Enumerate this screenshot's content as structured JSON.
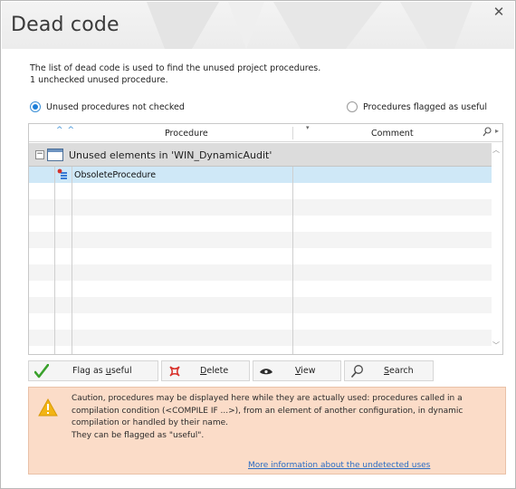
{
  "window": {
    "title": "Dead code",
    "close_glyph": "✕"
  },
  "description": {
    "line1": "The list of dead code is used to find the unused project procedures.",
    "line2": "1 unchecked unused procedure."
  },
  "filters": {
    "unused_label": "Unused procedures not checked",
    "flagged_label": "Procedures flagged as useful",
    "selected": "unused"
  },
  "table": {
    "columns": {
      "procedure": "Procedure",
      "comment": "Comment"
    },
    "group": {
      "label": "Unused elements in 'WIN_DynamicAudit'"
    },
    "rows": [
      {
        "procedure": "ObsoleteProcedure",
        "comment": ""
      }
    ]
  },
  "buttons": {
    "flag": {
      "pre": "Flag as ",
      "key": "u",
      "post": "seful"
    },
    "delete": {
      "pre": "",
      "key": "D",
      "post": "elete"
    },
    "view": {
      "pre": "",
      "key": "V",
      "post": "iew"
    },
    "search": {
      "pre": "",
      "key": "S",
      "post": "earch"
    }
  },
  "warning": {
    "text1": "Caution, procedures may be displayed here while they are actually used: procedures called in a compilation condition (<COMPILE IF ...>), from an element of another configuration, in dynamic compilation or handled by their name.",
    "text2": "They can be flagged as \"useful\".",
    "link": "More information about the undetected uses"
  },
  "colors": {
    "accent": "#1e7fd8",
    "selected_row": "#cfe8f7",
    "warning_bg": "#fbdcc8",
    "link": "#2a6cc4"
  },
  "icons": {
    "close": "close-icon",
    "sort": "sort-arrow-icon",
    "column_search": "search-icon",
    "group": "window-icon",
    "procedure": "procedure-icon",
    "flag": "checkmark-icon",
    "delete": "delete-icon",
    "view": "eye-icon",
    "search": "magnifier-icon",
    "warning": "warning-icon"
  }
}
